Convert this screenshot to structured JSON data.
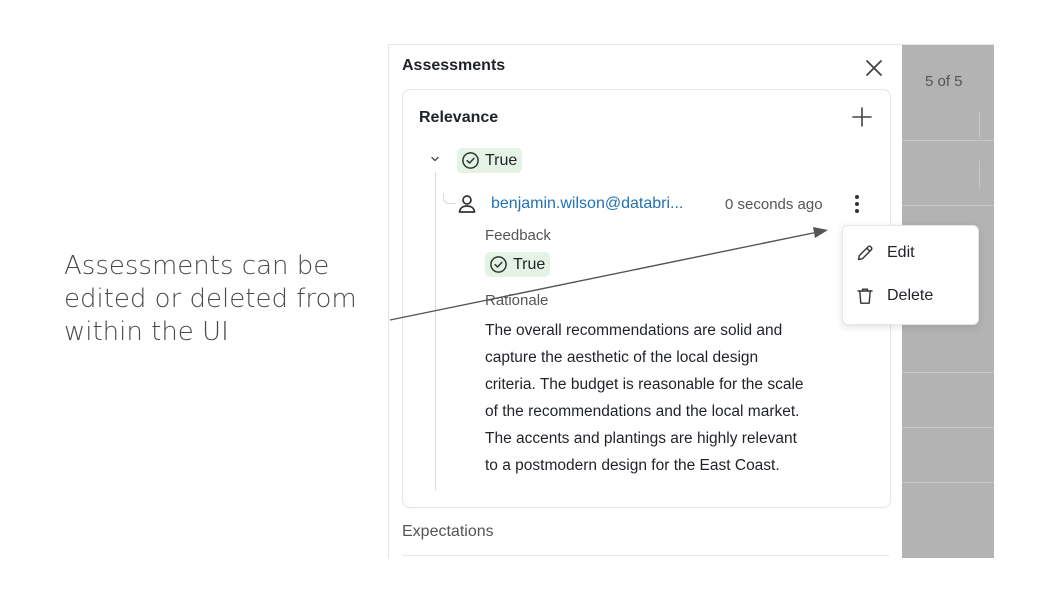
{
  "annotation": {
    "lines": [
      "Assessments can be",
      "edited or deleted from",
      "within the UI"
    ]
  },
  "background": {
    "pager": "5 of 5"
  },
  "panel": {
    "title": "Assessments",
    "assessment": {
      "name": "Relevance",
      "value": "True",
      "entry": {
        "user": "benjamin.wilson@databri...",
        "timestamp": "0 seconds ago",
        "feedback_label": "Feedback",
        "feedback_value": "True",
        "rationale_label": "Rationale",
        "rationale_lines": [
          "The overall recommendations are solid and",
          "capture the aesthetic of the local design",
          "criteria. The budget is reasonable for the scale",
          "of the recommendations and the local market.",
          "The accents and plantings are highly relevant",
          "to a postmodern design for the East Coast."
        ]
      }
    },
    "expectations_label": "Expectations"
  },
  "context_menu": {
    "edit_label": "Edit",
    "delete_label": "Delete"
  },
  "colors": {
    "accent_link": "#2272b4",
    "true_pill_bg": "#e4f3e6",
    "overlay_gray": "#b3b3b3"
  },
  "icons": {
    "close": "close-icon",
    "add": "plus-icon",
    "expand": "chevron-down-icon",
    "status": "check-circle-icon",
    "user": "user-icon",
    "more": "kebab-icon",
    "edit": "pencil-icon",
    "delete": "trash-icon"
  }
}
